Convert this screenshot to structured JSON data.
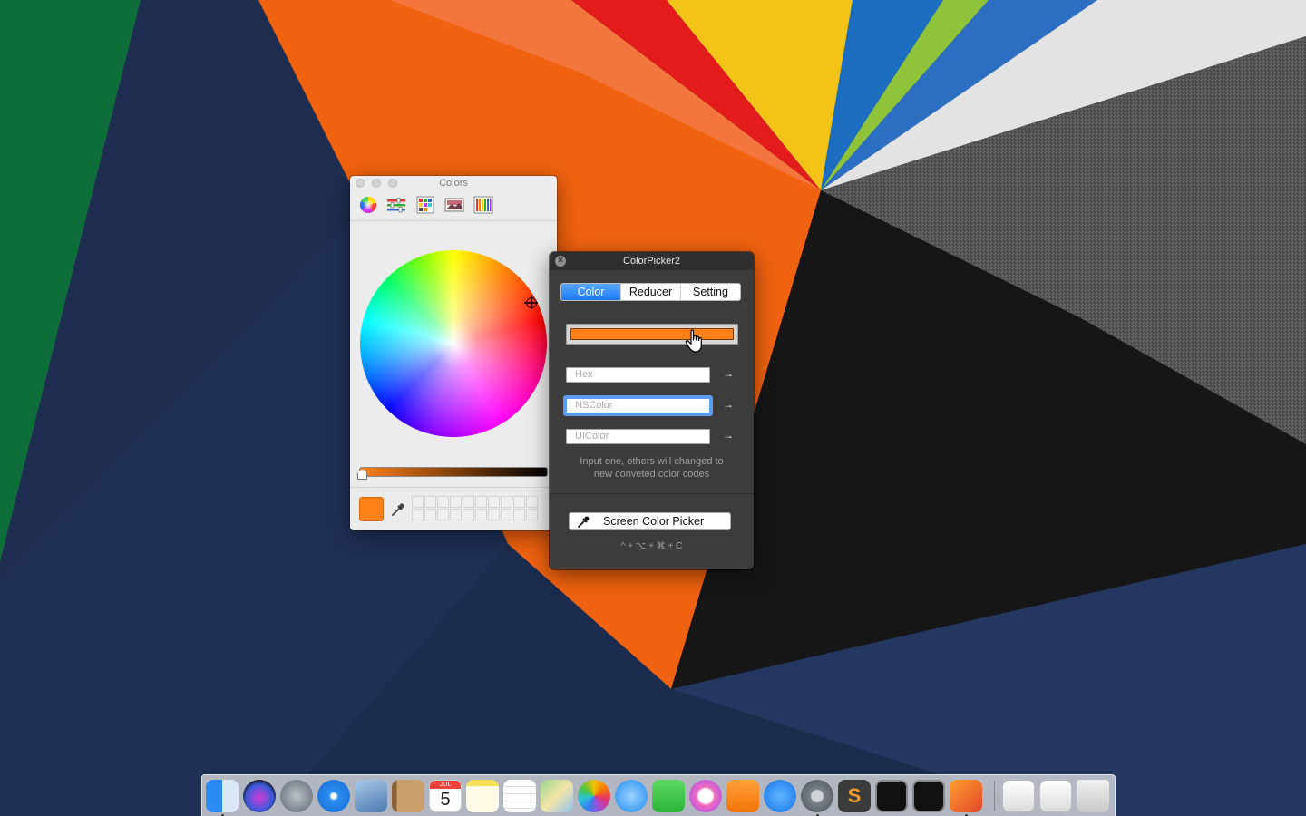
{
  "colors_panel": {
    "title": "Colors",
    "tools": [
      "color-wheel-icon",
      "sliders-icon",
      "palettes-icon",
      "image-palettes-icon",
      "pencils-icon"
    ],
    "current_color": "#ff7f18",
    "brightness_fraction": 0.04
  },
  "colorpicker2": {
    "title": "ColorPicker2",
    "tabs": [
      "Color",
      "Reducer",
      "Setting"
    ],
    "active_tab": "Color",
    "current_color": "#ff7f18",
    "hex": {
      "placeholder": "Hex"
    },
    "nscolor": {
      "placeholder": "NSColor"
    },
    "uicolor": {
      "placeholder": "UIColor"
    },
    "hint_line1": "Input one, others will changed to",
    "hint_line2": "new conveted color codes",
    "screen_picker_label": "Screen Color Picker",
    "shortcut": "^ + ⌥ + ⌘ + C"
  },
  "dock": {
    "calendar_month": "JUL",
    "calendar_day": "5",
    "items": [
      "Finder",
      "Siri",
      "Launchpad",
      "Safari",
      "Mail",
      "Contacts",
      "Calendar",
      "Notes",
      "Reminders",
      "Maps",
      "Photos",
      "Messages",
      "FaceTime",
      "iTunes",
      "iBooks",
      "App Store",
      "System Preferences",
      "Sublime Text",
      "Terminal",
      "Activity Monitor",
      "Color Picker",
      "Folder 1",
      "Folder 2",
      "Trash"
    ]
  }
}
